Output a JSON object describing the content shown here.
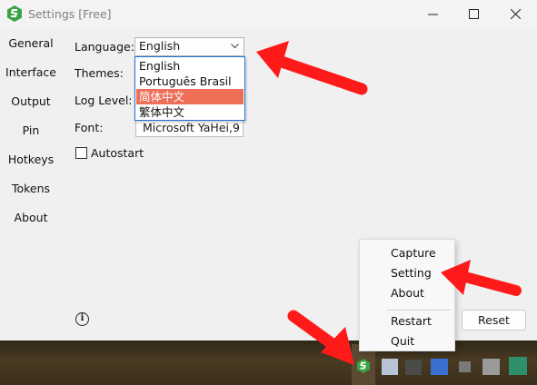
{
  "window": {
    "title": "Settings [Free]",
    "minimize_glyph": "—",
    "maximize_glyph": "☐",
    "close_glyph": "✕"
  },
  "sidebar": {
    "items": [
      {
        "label": "General"
      },
      {
        "label": "Interface"
      },
      {
        "label": "Output"
      },
      {
        "label": "Pin"
      },
      {
        "label": "Hotkeys"
      },
      {
        "label": "Tokens"
      },
      {
        "label": "About"
      }
    ]
  },
  "general": {
    "language_label": "Language:",
    "language_value": "English",
    "language_options": [
      "English",
      "Português Brasil",
      "简体中文",
      "繁体中文"
    ],
    "language_highlighted": "简体中文",
    "themes_label": "Themes:",
    "log_level_label": "Log Level:",
    "font_label": "Font:",
    "font_value": "Microsoft YaHei,9",
    "autostart_label": "Autostart",
    "autostart_checked": false,
    "info_glyph": "i",
    "reset_label": "Reset"
  },
  "tray_menu": {
    "items": [
      {
        "label": "Capture"
      },
      {
        "label": "Setting"
      },
      {
        "label": "About"
      },
      {
        "label": "Restart"
      },
      {
        "label": "Quit"
      }
    ]
  },
  "colors": {
    "highlight": "#ee6e57",
    "arrow": "#ff1a1a",
    "dropdown_border": "#1e73d9",
    "app_icon": "#3aa345"
  }
}
